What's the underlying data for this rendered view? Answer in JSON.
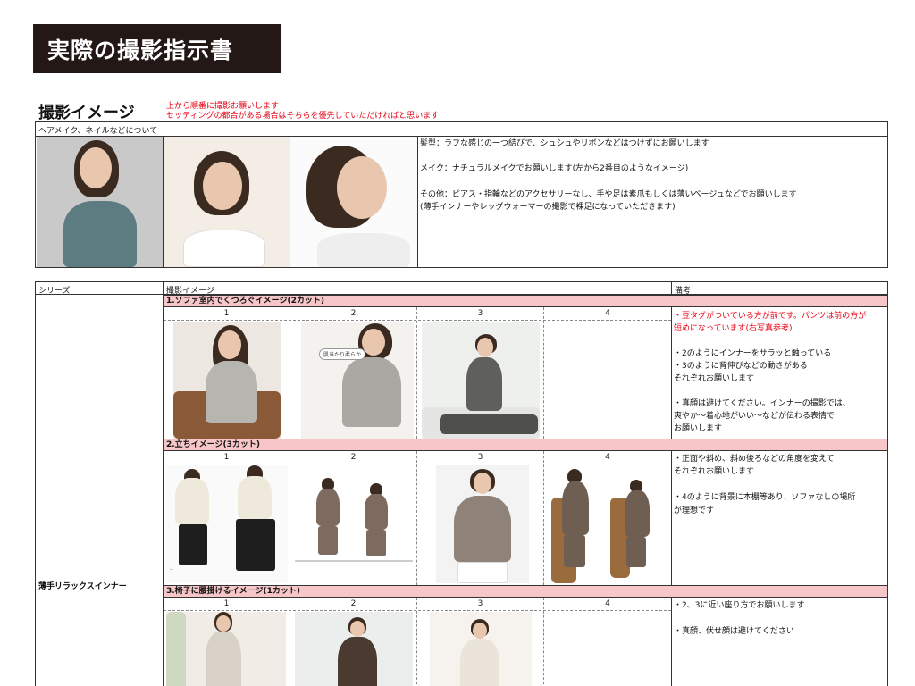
{
  "title": "実際の撮影指示書",
  "section_title": "撮影イメージ",
  "section_notes": [
    "上から順番に撮影お願いします",
    "セッティングの都合がある場合はそちらを優先していただければと思います"
  ],
  "hair_table": {
    "header": "ヘアメイク、ネイルなどについて",
    "notes": [
      "髪型：ラフな感じの一つ結びで、シュシュやリボンなどはつけずにお願いします",
      "メイク：ナチュラルメイクでお願いします(左から2番目のようなイメージ)",
      "その他：ピアス・指輪などのアクセサリーなし、手や足は素爪もしくは薄いベージュなどでお願いします",
      "(薄手インナーやレッグウォーマーの撮影で裸足になっていただきます)"
    ]
  },
  "main_table": {
    "headers": [
      "シリーズ",
      "撮影イメージ",
      "備考"
    ],
    "series_name": "薄手リラックスインナー",
    "numbers": [
      "1",
      "2",
      "3",
      "4"
    ],
    "sections": [
      {
        "title": "1.ソファ室内でくつろぐイメージ(2カット)",
        "bubble": "肌当たり柔らか",
        "notes": [
          "・豆タグがついている方が前です。パンツは前の方が",
          "短めになっています(右写真参考)",
          "・2のようにインナーをサラッと触っている",
          "・3のように背伸びなどの動きがある",
          "それぞれお願いします",
          "・真顔は避けてください。インナーの撮影では、",
          "爽やか〜着心地がいい〜などが伝わる表情で",
          "お願いします"
        ]
      },
      {
        "title": "2.立ちイメージ(3カット)",
        "notes": [
          "・正面や斜め、斜め後ろなどの角度を変えて",
          "それぞれお願いします",
          "・4のように背景に本棚等あり、ソファなしの場所",
          "が理想です"
        ]
      },
      {
        "title": "3.椅子に腰掛けるイメージ(1カット)",
        "notes": [
          "・2、3に近い座り方でお願いします",
          "・真顔、伏せ顔は避けてください"
        ]
      }
    ]
  },
  "colors": {
    "title_bg": "#231815",
    "note_red": "#e60012",
    "section_pink": "#f6c6c9"
  }
}
